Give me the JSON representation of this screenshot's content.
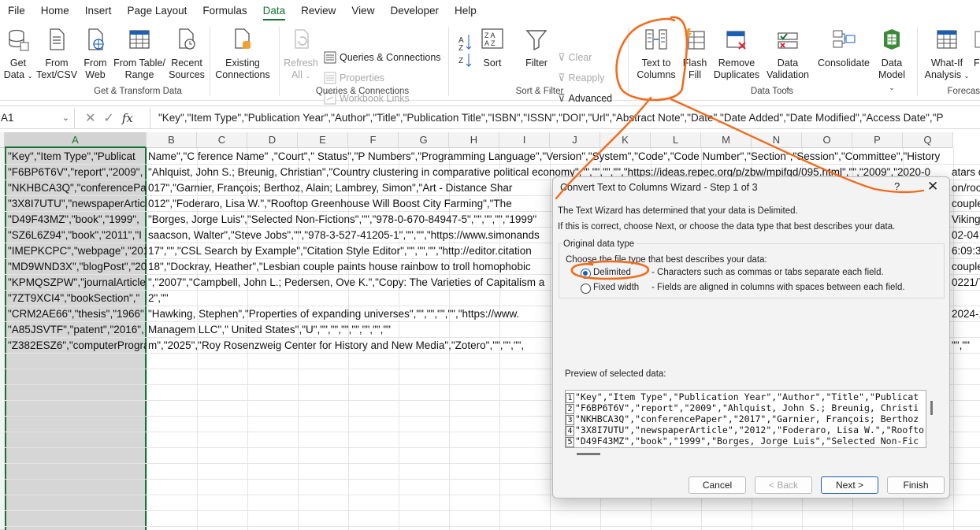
{
  "menu": [
    "File",
    "Home",
    "Insert",
    "Page Layout",
    "Formulas",
    "Data",
    "Review",
    "View",
    "Developer",
    "Help"
  ],
  "ribbon": {
    "get_data": [
      "Get",
      "Data"
    ],
    "from_text": [
      "From",
      "Text/CSV"
    ],
    "from_web": [
      "From",
      "Web"
    ],
    "from_table": [
      "From Table/",
      "Range"
    ],
    "recent_sources": [
      "Recent",
      "Sources"
    ],
    "existing": [
      "Existing",
      "Connections"
    ],
    "refresh": [
      "Refresh",
      "All"
    ],
    "queries": "Queries & Connections",
    "properties": "Properties",
    "workbook_links": "Workbook Links",
    "sort_az": "A Z",
    "sort": "Sort",
    "filter": "Filter",
    "clear": "Clear",
    "reapply": "Reapply",
    "advanced": "Advanced",
    "text_to_columns": [
      "Text to",
      "Columns"
    ],
    "flash_fill": [
      "Flash",
      "Fill"
    ],
    "remove_duplicates": [
      "Remove",
      "Duplicates"
    ],
    "data_validation": [
      "Data",
      "Validation"
    ],
    "consolidate": "Consolidate",
    "data_model": [
      "Data",
      "Model"
    ],
    "whatif": [
      "What-If",
      "Analysis"
    ],
    "forecast_partial": "Fo",
    "groups": [
      "Get & Transform Data",
      "Queries & Connections",
      "Sort & Filter",
      "Data Tools",
      "Forecas"
    ]
  },
  "formula_bar": {
    "name_box": "A1",
    "fx": "fx",
    "content": "\"Key\",\"Item Type\",\"Publication Year\",\"Author\",\"Title\",\"Publication Title\",\"ISBN\",\"ISSN\",\"DOI\",\"Url\",\"Abstract Note\",\"Date\",\"Date Added\",\"Date Modified\",\"Access Date\",\"P"
  },
  "columns": [
    "A",
    "B",
    "C",
    "D",
    "E",
    "F",
    "G",
    "H",
    "I",
    "J",
    "K",
    "L",
    "M",
    "N",
    "O",
    "P",
    "Q"
  ],
  "rows": [
    "\"Key\",\"Item Type\",\"Publicat",
    "\"F6BP6T6V\",\"report\",\"2009\",",
    "\"NKHBCA3Q\",\"conferencePap",
    "\"3X8I7UTU\",\"newspaperArticl",
    "\"D49F43MZ\",\"book\",\"1999\",",
    "\"SZ6L6Z94\",\"book\",\"2011\",\"I",
    "\"IMEPKCPC\",\"webpage\",\"2017\"",
    "\"MD9WND3X\",\"blogPost\",\"20",
    "\"KPMQSZPW\",\"journalArticle",
    "\"7ZT9XCI4\",\"bookSection\",\"",
    "\"CRM2AE66\",\"thesis\",\"1966\"",
    "\"A85JSVTF\",\"patent\",\"2016\",",
    "\"Z382ESZ6\",\"computerProgra"
  ],
  "rows_rest": [
    " Name\",\"C ference    Name\"    ,\"Court\",\" Status\",\"P Numbers\",\"Programming Language\",\"Version\",\"System\",\"Code\",\"Code Number\",\"Section\",\"Session\",\"Committee\",\"History",
    "\"Ahlquist, John S.; Breunig, Christian\",\"Country clustering in comparative political economy\",\"\",\"\",\"\",\"\",\"https://ideas.repec.org/p/zbw/mpifgd/095.html\",\"\",\"2009\",\"2020-0",
    "017\",\"Garnier, François; Berthoz, Alain; Lambrey, Simon\",\"Art - Distance Shar",
    "012\",\"Foderaro, Lisa W.\",\"Rooftop Greenhouse Will Boost City Farming\",\"The",
    "\"Borges, Jorge Luis\",\"Selected Non-Fictions\",\"\",\"978-0-670-84947-5\",\"\",\"\",\"\",\"1999\"",
    "saacson, Walter\",\"Steve Jobs\",\"\",\"978-3-527-41205-1\",\"\",\"\",\"https://www.simonands",
    "17\",\"\",\"CSL Search by Example\",\"Citation Style Editor\",\"\",\"\",\"\",\"http://editor.citation",
    "18\",\"Dockray, Heather\",\"Lesbian couple paints house rainbow to troll homophobic",
    "\",\"2007\",\"Campbell, John L.; Pedersen, Ove K.\",\"Copy: The Varieties of Capitalism a",
    "2\",\"\"",
    "\"Hawking, Stephen\",\"Properties of expanding universes\",\"\",\"\",\"\",\"\",\"https://www.",
    " Managem LLC\",\"        United        States\",\"U\",\"\",\"\",\"\",\"\",\"\",\"\",\"\"",
    "m\",\"2025\",\"Roy Rosenzweig Center for History and New Media\",\"Zotero\",\"\",\"\",\"\","
  ],
  "right_fragments": [
    "atars c",
    "on/roo",
    "couple",
    "Viking",
    "02-04",
    "6:09:3",
    "couple",
    "0221/7",
    "2024-1",
    "\"\",\"\""
  ],
  "dialog": {
    "title": "Convert Text to Columns Wizard - Step 1 of 3",
    "help": "?",
    "close": "✕",
    "line1": "The Text Wizard has determined that your data is Delimited.",
    "line2": "If this is correct, choose Next, or choose the data type that best describes your data.",
    "group_label": "Original data type",
    "choose_label": "Choose the file type that best describes your data:",
    "opt1": "Delimited",
    "opt1_desc": "- Characters such as commas or tabs separate each field.",
    "opt2": "Fixed width",
    "opt2_desc": "- Fields are aligned in columns with spaces between each field.",
    "preview_label": "Preview of selected data:",
    "preview": [
      {
        "n": "1",
        "t": "\"Key\",\"Item Type\",\"Publication Year\",\"Author\",\"Title\",\"Publicat"
      },
      {
        "n": "2",
        "t": "\"F6BP6T6V\",\"report\",\"2009\",\"Ahlquist, John S.; Breunig, Christi"
      },
      {
        "n": "3",
        "t": "\"NKHBCA3Q\",\"conferencePaper\",\"2017\",\"Garnier, François; Berthoz"
      },
      {
        "n": "4",
        "t": "\"3X8I7UTU\",\"newspaperArticle\",\"2012\",\"Foderaro, Lisa W.\",\"Roofto"
      },
      {
        "n": "5",
        "t": "\"D49F43MZ\",\"book\",\"1999\",\"Borges, Jorge Luis\",\"Selected Non-Fic"
      }
    ],
    "cancel": "Cancel",
    "back": "< Back",
    "next": "Next >",
    "finish": "Finish"
  },
  "colors": {
    "accent": "#137333",
    "annotation": "#f26b1d",
    "primary": "#1a5fb4"
  }
}
